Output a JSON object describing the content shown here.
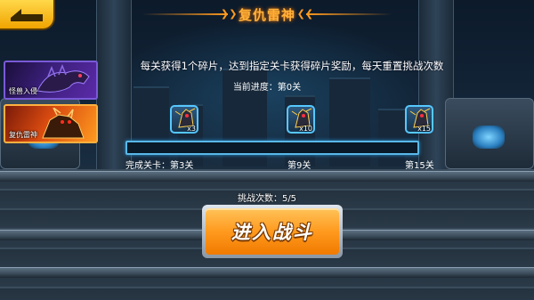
{
  "header": {
    "title": "复仇雷神"
  },
  "sidebar": {
    "tabs": [
      {
        "label": "怪兽入侵",
        "selected": false
      },
      {
        "label": "复仇雷神",
        "selected": true
      }
    ]
  },
  "main": {
    "description": "每关获得1个碎片，达到指定关卡获得碎片奖励，每天重置挑战次数",
    "current_progress": "当前进度：第0关",
    "progress_fraction": 0,
    "rewards": [
      {
        "count": "x3",
        "icon": "fragment-icon"
      },
      {
        "count": "x10",
        "icon": "fragment-icon"
      },
      {
        "count": "x15",
        "icon": "fragment-icon"
      }
    ],
    "stage_labels": [
      "完成关卡：第3关",
      "第9关",
      "第15关"
    ],
    "challenge_count": "挑战次数：5/5",
    "enter_button": "进入战斗"
  },
  "colors": {
    "accent": "#ff9a1e",
    "progress": "#58b8e8",
    "button": "#ff9a1e"
  }
}
